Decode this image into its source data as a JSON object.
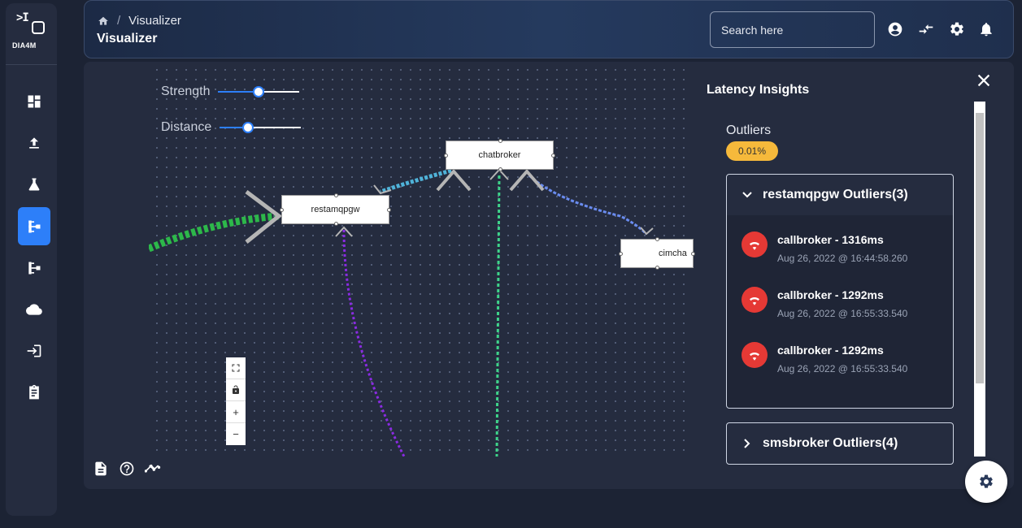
{
  "app": {
    "brand": "DIA4M",
    "collapse_glyph": ">I"
  },
  "sidebar": {
    "items": [
      {
        "name": "dashboard",
        "icon": "dashboard-icon",
        "active": false
      },
      {
        "name": "upload",
        "icon": "upload-icon",
        "active": false
      },
      {
        "name": "lab",
        "icon": "flask-icon",
        "active": false
      },
      {
        "name": "visualizer",
        "icon": "flow-tree-icon",
        "active": true
      },
      {
        "name": "topology",
        "icon": "flow-tree-icon",
        "active": false
      },
      {
        "name": "cloud",
        "icon": "cloud-icon",
        "active": false
      },
      {
        "name": "login",
        "icon": "login-icon",
        "active": false
      },
      {
        "name": "reports",
        "icon": "clipboard-icon",
        "active": false
      }
    ]
  },
  "header": {
    "breadcrumb": {
      "current": "Visualizer",
      "separator": "/"
    },
    "title": "Visualizer",
    "search": {
      "placeholder": "Search here",
      "value": ""
    }
  },
  "controls": {
    "strength": {
      "label": "Strength",
      "value": 0.5
    },
    "distance": {
      "label": "Distance",
      "value": 0.35
    }
  },
  "graph": {
    "nodes": [
      {
        "id": "chatbroker",
        "label": "chatbroker"
      },
      {
        "id": "restamqpgw",
        "label": "restamqpgw"
      },
      {
        "id": "cimcha",
        "label": "cimcha"
      }
    ],
    "zoom": {
      "fit": "fit-icon",
      "lock": "lock-icon",
      "plus": "+",
      "minus": "−"
    }
  },
  "insights": {
    "title": "Latency Insights",
    "outliers_label": "Outliers",
    "outlier_rate": "0.01%",
    "groups": [
      {
        "title": "restamqpgw Outliers(3)",
        "expanded": true,
        "items": [
          {
            "title": "callbroker - 1316ms",
            "time": "Aug 26, 2022 @ 16:44:58.260"
          },
          {
            "title": "callbroker - 1292ms",
            "time": "Aug 26, 2022 @ 16:55:33.540"
          },
          {
            "title": "callbroker - 1292ms",
            "time": "Aug 26, 2022 @ 16:55:33.540"
          }
        ]
      },
      {
        "title": "smsbroker Outliers(4)",
        "expanded": false
      }
    ]
  },
  "colors": {
    "accent": "#2d7ff9",
    "badge": "#f6b93b",
    "outlier_icon": "#e53935",
    "edge_green": "#2db84a",
    "edge_cyan": "#4fb3d9",
    "edge_blue": "#6a8cf0",
    "edge_purple": "#8a2be2"
  }
}
